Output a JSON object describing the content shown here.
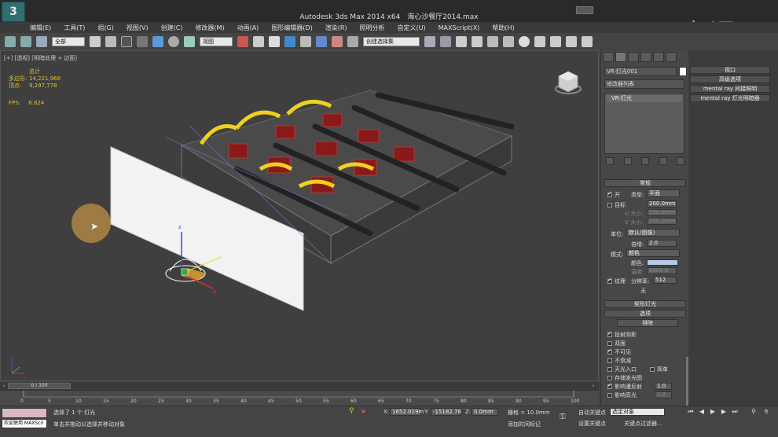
{
  "window": {
    "app_title": "Autodesk 3ds Max  2014 x64",
    "file_name": "海心沙餐厅2014.max",
    "watermark": "虎课网"
  },
  "menu": [
    "编辑(E)",
    "工具(T)",
    "组(G)",
    "视图(V)",
    "创建(C)",
    "修改器(M)",
    "动画(A)",
    "图形编辑器(D)",
    "渲染(R)",
    "照明分析",
    "自定义(U)",
    "MAXScript(X)",
    "帮助(H)"
  ],
  "toolbar": {
    "selection_filter": "全部",
    "coord_system": "视图",
    "named_selection": "创建选择集"
  },
  "viewport": {
    "label": "[+] [透视] [明暗处理 + 边面]",
    "stats": {
      "total_label": "总计",
      "polys_label": "多边形:",
      "polys_value": "14,221,968",
      "verts_label": "顶点:",
      "verts_value": "9,297,778",
      "fps_label": "FPS:",
      "fps_value": "6.824"
    }
  },
  "command_panel": {
    "object_name": "VR-灯光001",
    "modifier_list": "修改器列表",
    "stack_item": "VR-灯光",
    "general_rollout": "常规",
    "on_label": "开",
    "type_label": "类型:",
    "type_value": "平面",
    "target_label": "目标",
    "target_value": "200.0mm",
    "usize_label": "U 大小:",
    "usize_value": "150.0mm",
    "vsize_label": "V 大小:",
    "vsize_value": "500.0mm",
    "units_label": "单位:",
    "units_value": "默认(图像)",
    "mult_label": "倍增:",
    "mult_value": "2.0",
    "mode_label": "模式:",
    "mode_value": "颜色",
    "color_label": "颜色:",
    "temp_label": "温度:",
    "temp_value": "6500.0",
    "texture_label": "纹理",
    "resolution_label": "分辨率:",
    "resolution_value": "512",
    "none_label": "无",
    "rect_rollout": "矩形灯光",
    "options_rollout": "选项",
    "exclude_button": "排除",
    "options": [
      {
        "label": "投射阴影",
        "checked": true
      },
      {
        "label": "双面",
        "checked": false
      },
      {
        "label": "不可见",
        "checked": true
      },
      {
        "label": "不衰减",
        "checked": false
      },
      {
        "label": "天光入口",
        "checked": false
      },
      {
        "label": "存储发光图",
        "checked": false
      },
      {
        "label": "影响漫反射",
        "checked": true
      },
      {
        "label": "影响高光",
        "checked": false
      }
    ],
    "simple_label": "简单",
    "diffuse_value": "1.0",
    "specular_value": "1.0"
  },
  "viewport_panel": {
    "items": [
      "视口",
      "高级选项",
      "mental ray 间接照明",
      "mental ray 灯光明暗器"
    ]
  },
  "timeline": {
    "frame_display": "0 / 100",
    "ticks": [
      "0",
      "5",
      "10",
      "15",
      "20",
      "25",
      "30",
      "35",
      "40",
      "45",
      "50",
      "55",
      "60",
      "65",
      "70",
      "75",
      "80",
      "85",
      "90",
      "95",
      "100"
    ]
  },
  "status": {
    "maxscript_text": "欢迎使用 MAXScri",
    "selection": "选择了 1 个 灯光",
    "prompt": "单击并拖动以选择并移动对象",
    "x_label": "X:",
    "x_value": "1652.019m",
    "y_label": "Y:",
    "y_value": "-15182.78",
    "z_label": "Z:",
    "z_value": "0.0mm",
    "grid_label": "栅格 = 10.0mm",
    "add_time_tag": "添加时间标记",
    "auto_key": "自动关键点",
    "set_key": "设置关键点",
    "key_mode": "选定对象",
    "key_filter": "关键点过滤器..."
  }
}
